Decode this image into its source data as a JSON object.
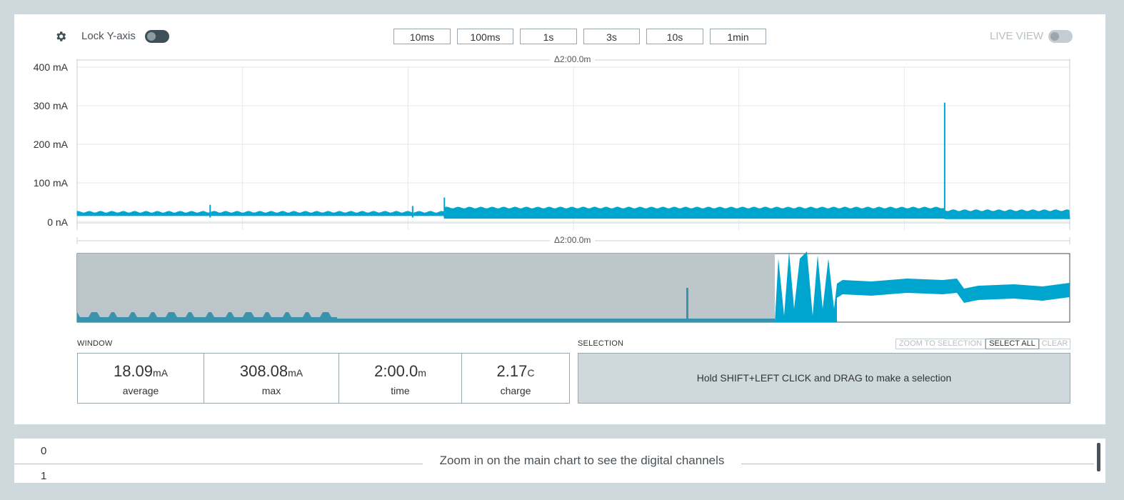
{
  "toolbar": {
    "lock_y_label": "Lock Y-axis",
    "time_buttons": [
      "10ms",
      "100ms",
      "1s",
      "3s",
      "10s",
      "1min"
    ],
    "live_view_label": "LIVE VIEW"
  },
  "main_chart": {
    "delta_label": "Δ2:00.0m",
    "y_ticks": [
      "400 mA",
      "300 mA",
      "200 mA",
      "100 mA",
      "0 nA"
    ]
  },
  "minimap": {
    "delta_label": "Δ2:00.0m"
  },
  "window": {
    "section_label": "WINDOW",
    "stats": [
      {
        "value": "18.09",
        "unit": "mA",
        "caption": "average"
      },
      {
        "value": "308.08",
        "unit": "mA",
        "caption": "max"
      },
      {
        "value": "2:00.0",
        "unit": "m",
        "caption": "time"
      },
      {
        "value": "2.17",
        "unit": "C",
        "caption": "charge"
      }
    ]
  },
  "selection": {
    "section_label": "SELECTION",
    "zoom_label": "ZOOM TO SELECTION",
    "select_all_label": "SELECT ALL",
    "clear_label": "CLEAR",
    "hint": "Hold SHIFT+LEFT CLICK and DRAG to make a selection"
  },
  "digital": {
    "channel_0": "0",
    "channel_1": "1",
    "message": "Zoom in on the main chart to see the digital channels"
  },
  "chart_data": {
    "type": "area",
    "title": "",
    "ylabel": "",
    "ylim_mA": [
      0,
      400
    ],
    "y_ticks": [
      "400 mA",
      "300 mA",
      "200 mA",
      "100 mA",
      "0 nA"
    ],
    "x_window": "Δ2:00.0m",
    "series": [
      {
        "color": "#00a5cf",
        "segments": [
          {
            "x_frac": [
              0.0,
              0.37
            ],
            "band_mA": [
              15,
              24
            ]
          },
          {
            "x_frac": [
              0.37,
              0.874
            ],
            "band_mA": [
              8,
              35
            ]
          },
          {
            "x_frac": [
              0.874,
              1.0
            ],
            "band_mA": [
              7,
              28
            ]
          }
        ],
        "spikes": [
          {
            "x_frac": 0.134,
            "peak_mA": 43
          },
          {
            "x_frac": 0.338,
            "peak_mA": 40
          },
          {
            "x_frac": 0.37,
            "peak_mA": 62
          },
          {
            "x_frac": 0.874,
            "peak_mA": 308
          }
        ]
      }
    ],
    "grid": true,
    "legend": "none"
  }
}
